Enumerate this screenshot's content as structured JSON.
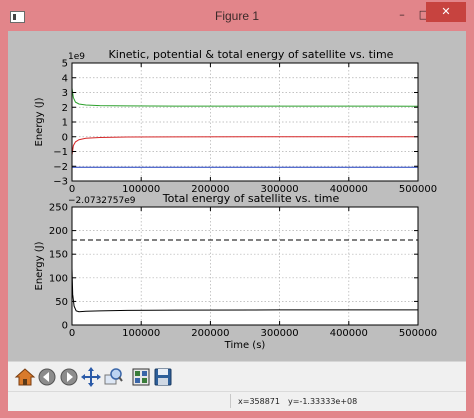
{
  "window": {
    "title": "Figure 1",
    "minimize_glyph": "–",
    "maximize_glyph": "□",
    "close_glyph": "✕"
  },
  "toolbar": {
    "buttons": [
      {
        "name": "home-button",
        "icon": "home-icon"
      },
      {
        "name": "back-button",
        "icon": "back-arrow-icon"
      },
      {
        "name": "forward-button",
        "icon": "forward-arrow-icon"
      },
      {
        "name": "pan-button",
        "icon": "pan-icon"
      },
      {
        "name": "zoom-button",
        "icon": "zoom-icon"
      },
      {
        "name": "subplots-button",
        "icon": "subplots-icon"
      },
      {
        "name": "save-button",
        "icon": "save-icon"
      }
    ]
  },
  "status": {
    "x": "x=358871",
    "y": "y=-1.33333e+08"
  },
  "chart_data": [
    {
      "type": "line",
      "title": "Kinetic, potential & total energy of satellite vs. time",
      "xlabel": "",
      "ylabel": "Energy (J)",
      "offset_label": "1e9",
      "xlim": [
        0,
        500000
      ],
      "ylim": [
        -3,
        5
      ],
      "xticks": [
        0,
        100000,
        200000,
        300000,
        400000,
        500000
      ],
      "yticks": [
        -3,
        -2,
        -1,
        0,
        1,
        2,
        3,
        4,
        5
      ],
      "grid": true,
      "series": [
        {
          "color": "#2ca02c",
          "x": [
            0,
            2000,
            5000,
            10000,
            20000,
            40000,
            80000,
            150000,
            300000,
            500000
          ],
          "y": [
            3.3,
            2.65,
            2.35,
            2.22,
            2.15,
            2.11,
            2.09,
            2.08,
            2.08,
            2.07
          ]
        },
        {
          "color": "#1f3fbf",
          "x": [
            0,
            500000
          ],
          "y": [
            -2.07,
            -2.07
          ]
        },
        {
          "color": "#d62728",
          "x": [
            0,
            2000,
            5000,
            10000,
            20000,
            40000,
            80000,
            150000,
            300000,
            500000
          ],
          "y": [
            -1.25,
            -0.6,
            -0.35,
            -0.2,
            -0.1,
            -0.05,
            -0.02,
            -0.01,
            0.0,
            0.0
          ]
        }
      ]
    },
    {
      "type": "line",
      "title": "Total energy of satellite vs. time",
      "xlabel": "Time (s)",
      "ylabel": "Energy (J)",
      "offset_label": "−2.0732757e9",
      "xlim": [
        0,
        500000
      ],
      "ylim": [
        0,
        250
      ],
      "xticks": [
        0,
        100000,
        200000,
        300000,
        400000,
        500000
      ],
      "yticks": [
        0,
        50,
        100,
        150,
        200,
        250
      ],
      "grid": true,
      "series": [
        {
          "color": "#000000",
          "x": [
            0,
            1000,
            3000,
            6000,
            10000,
            20000,
            40000,
            80000,
            150000,
            300000,
            500000
          ],
          "y": [
            120,
            65,
            40,
            30,
            28,
            29,
            30,
            31,
            31.5,
            32,
            32
          ]
        }
      ],
      "hline": {
        "y": 180,
        "style": "dashed",
        "color": "#000000"
      }
    }
  ]
}
